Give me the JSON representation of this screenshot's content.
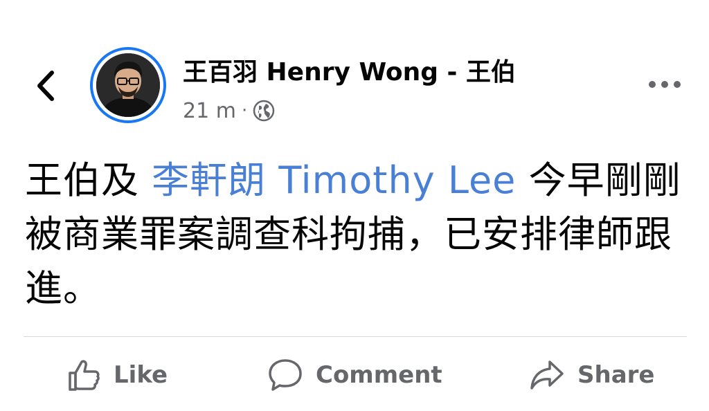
{
  "header": {
    "author_name": "王百羽 Henry Wong - 王伯",
    "timestamp": "21 m",
    "separator": "·",
    "privacy_icon": "globe-icon",
    "back_icon": "chevron-left-icon",
    "more_icon": "more-horizontal-icon"
  },
  "post": {
    "text_before": "王伯及 ",
    "mention": "李軒朗 Timothy Lee",
    "text_after": " 今早剛剛被商業罪案調查科拘捕，已安排律師跟進。"
  },
  "actions": {
    "like_label": "Like",
    "comment_label": "Comment",
    "share_label": "Share"
  },
  "colors": {
    "accent": "#1877f2",
    "mention": "#4a7fd6",
    "secondary_text": "#65676b",
    "divider": "#d6d8db"
  }
}
